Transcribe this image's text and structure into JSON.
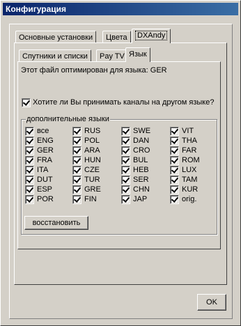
{
  "window": {
    "title": "Конфигурация"
  },
  "tabs_top": [
    "Основные установки",
    "Цвета",
    "DXAndy"
  ],
  "tabs_sub": [
    "Спутники и списки",
    "Pay TV",
    "Язык"
  ],
  "info_text": "Этот файл оптимирован для языка: GER",
  "accept_other_lang": {
    "label": "Хотите ли Вы принимать каналы на другом языке?",
    "checked": true
  },
  "languages": {
    "caption": "дополнительные языки",
    "columns": [
      [
        "все",
        "ENG",
        "GER",
        "FRA",
        "ITA",
        "DUT",
        "ESP",
        "POR"
      ],
      [
        "RUS",
        "POL",
        "ARA",
        "HUN",
        "CZE",
        "TUR",
        "GRE",
        "FIN"
      ],
      [
        "SWE",
        "DAN",
        "CRO",
        "BUL",
        "HEB",
        "SER",
        "CHN",
        "JAP"
      ],
      [
        "VIT",
        "THA",
        "FAR",
        "ROM",
        "LUX",
        "TAM",
        "KUR",
        "orig."
      ]
    ],
    "restore_label": "восстановить"
  },
  "ok_label": "OK"
}
